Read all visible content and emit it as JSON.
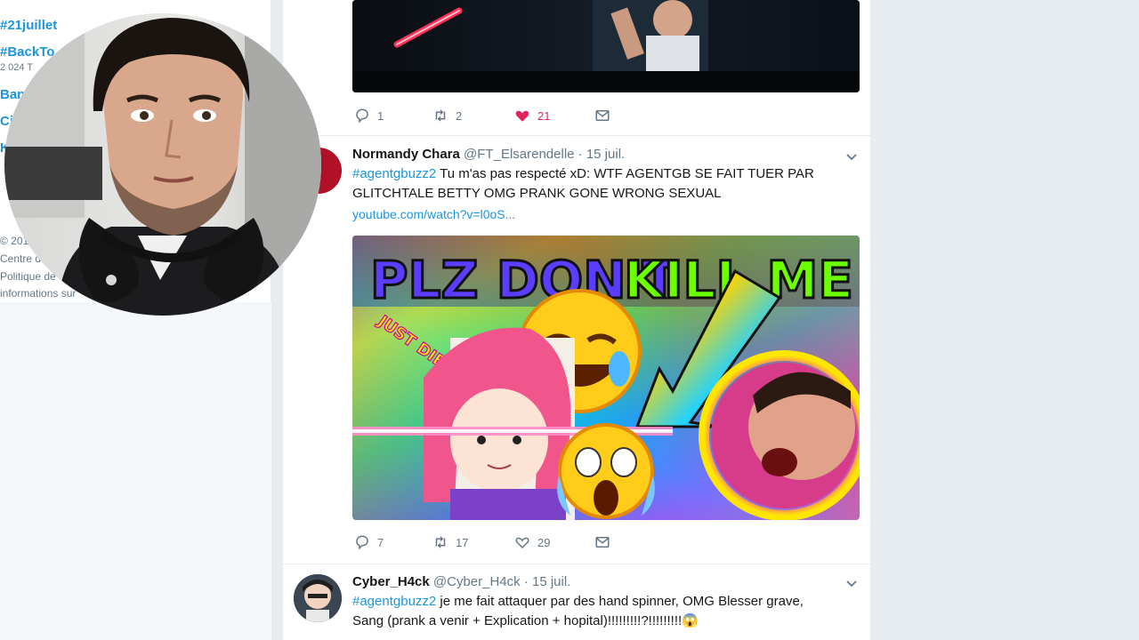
{
  "left": {
    "trends": [
      {
        "tag": "#21juillet",
        "meta": ""
      },
      {
        "tag": "#BackTo",
        "meta": "2 024 T"
      },
      {
        "tag": "Ban",
        "meta": ""
      },
      {
        "tag": "Ci",
        "meta": ""
      },
      {
        "tag": "K",
        "meta": ""
      }
    ],
    "footer": [
      "© 201",
      "Centre d",
      "Politique de",
      "informations sur"
    ]
  },
  "tweets": [
    {
      "actions": {
        "reply": "1",
        "retweet": "2",
        "like": "21"
      }
    },
    {
      "name": "Normandy Chara",
      "handle": "@FT_Elsarendelle",
      "time": "· 15 juil.",
      "hashtag": "#agentgbuzz2",
      "text_line1": " Tu m'as pas respecté xD: WTF AGENTGB SE FAIT TUER PAR",
      "text_line2": "GLITCHTALE BETTY OMG PRANK GONE WRONG SEXUAL",
      "link": "youtube.com/watch?v=l0oS...",
      "thumb_title_a": "PLZ DON'T ",
      "thumb_title_b": "KILL ME !",
      "thumb_sticker": "JUST DIE !",
      "actions": {
        "reply": "7",
        "retweet": "17",
        "like": "29"
      }
    },
    {
      "name": "Cyber_H4ck",
      "handle": "@Cyber_H4ck",
      "time": "· 15 juil.",
      "hashtag": "#agentgbuzz2",
      "text_line1": " je me fait attaquer par des hand spinner, OMG Blesser grave,",
      "text_line2": "Sang (prank a venir + Explication + hopital)!!!!!!!!!?!!!!!!!!!😱"
    }
  ],
  "colors": {
    "accent": "#1b95e0",
    "like": "#e0245e",
    "muted": "#657786"
  }
}
